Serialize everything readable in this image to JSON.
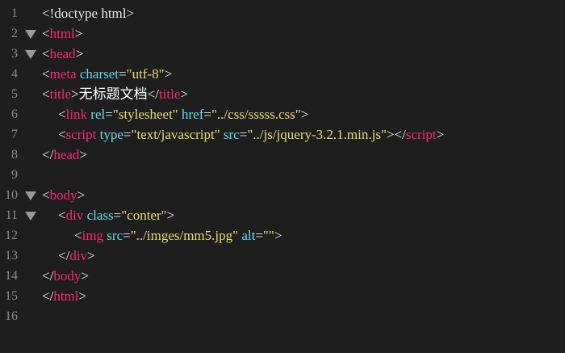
{
  "colors": {
    "background": "#1e1e1e",
    "line_number": "#8a8a8a",
    "fold_marker": "#9a9a9a",
    "punctuation": "#e8e8e8",
    "tag": "#f92672",
    "attr": "#66d9ef",
    "string": "#e6db74",
    "text": "#ffffff"
  },
  "editor": {
    "lines": [
      {
        "num": "1",
        "fold": false,
        "indent": 0,
        "tokens": [
          {
            "t": "<!doctype html>",
            "k": "p"
          }
        ]
      },
      {
        "num": "2",
        "fold": true,
        "indent": 0,
        "tokens": [
          {
            "t": "<",
            "k": "p"
          },
          {
            "t": "html",
            "k": "tag"
          },
          {
            "t": ">",
            "k": "p"
          }
        ]
      },
      {
        "num": "3",
        "fold": true,
        "indent": 0,
        "tokens": [
          {
            "t": "<",
            "k": "p"
          },
          {
            "t": "head",
            "k": "tag"
          },
          {
            "t": ">",
            "k": "p"
          }
        ]
      },
      {
        "num": "4",
        "fold": false,
        "indent": 0,
        "tokens": [
          {
            "t": "<",
            "k": "p"
          },
          {
            "t": "meta",
            "k": "tag"
          },
          {
            "t": " ",
            "k": "p"
          },
          {
            "t": "charset",
            "k": "attr"
          },
          {
            "t": "=",
            "k": "p"
          },
          {
            "t": "\"utf-8\"",
            "k": "str"
          },
          {
            "t": ">",
            "k": "p"
          }
        ]
      },
      {
        "num": "5",
        "fold": false,
        "indent": 0,
        "tokens": [
          {
            "t": "<",
            "k": "p"
          },
          {
            "t": "title",
            "k": "tag"
          },
          {
            "t": ">",
            "k": "p"
          },
          {
            "t": "无标题文档",
            "k": "text"
          },
          {
            "t": "</",
            "k": "p"
          },
          {
            "t": "title",
            "k": "tag"
          },
          {
            "t": ">",
            "k": "p"
          }
        ]
      },
      {
        "num": "6",
        "fold": false,
        "indent": 1,
        "tokens": [
          {
            "t": "<",
            "k": "p"
          },
          {
            "t": "link",
            "k": "tag"
          },
          {
            "t": " ",
            "k": "p"
          },
          {
            "t": "rel",
            "k": "attr"
          },
          {
            "t": "=",
            "k": "p"
          },
          {
            "t": "\"stylesheet\"",
            "k": "str"
          },
          {
            "t": " ",
            "k": "p"
          },
          {
            "t": "href",
            "k": "attr"
          },
          {
            "t": "=",
            "k": "p"
          },
          {
            "t": "\"../css/sssss.css\"",
            "k": "str"
          },
          {
            "t": ">",
            "k": "p"
          }
        ]
      },
      {
        "num": "7",
        "fold": false,
        "indent": 1,
        "tokens": [
          {
            "t": "<",
            "k": "p"
          },
          {
            "t": "script",
            "k": "tag"
          },
          {
            "t": " ",
            "k": "p"
          },
          {
            "t": "type",
            "k": "attr"
          },
          {
            "t": "=",
            "k": "p"
          },
          {
            "t": "\"text/javascript\"",
            "k": "str"
          },
          {
            "t": " ",
            "k": "p"
          },
          {
            "t": "src",
            "k": "attr"
          },
          {
            "t": "=",
            "k": "p"
          },
          {
            "t": "\"../js/jquery-3.2.1.min.js\"",
            "k": "str"
          },
          {
            "t": "></",
            "k": "p"
          },
          {
            "t": "script",
            "k": "tag"
          },
          {
            "t": ">",
            "k": "p"
          }
        ]
      },
      {
        "num": "8",
        "fold": false,
        "indent": 0,
        "tokens": [
          {
            "t": "</",
            "k": "p"
          },
          {
            "t": "head",
            "k": "tag"
          },
          {
            "t": ">",
            "k": "p"
          }
        ]
      },
      {
        "num": "9",
        "fold": false,
        "indent": 0,
        "tokens": []
      },
      {
        "num": "10",
        "fold": true,
        "indent": 0,
        "tokens": [
          {
            "t": "<",
            "k": "p"
          },
          {
            "t": "body",
            "k": "tag"
          },
          {
            "t": ">",
            "k": "p"
          }
        ]
      },
      {
        "num": "11",
        "fold": true,
        "indent": 1,
        "tokens": [
          {
            "t": "<",
            "k": "p"
          },
          {
            "t": "div",
            "k": "tag"
          },
          {
            "t": " ",
            "k": "p"
          },
          {
            "t": "class",
            "k": "attr"
          },
          {
            "t": "=",
            "k": "p"
          },
          {
            "t": "\"conter\"",
            "k": "str"
          },
          {
            "t": ">",
            "k": "p"
          }
        ]
      },
      {
        "num": "12",
        "fold": false,
        "indent": 2,
        "tokens": [
          {
            "t": "<",
            "k": "p"
          },
          {
            "t": "img",
            "k": "tag"
          },
          {
            "t": " ",
            "k": "p"
          },
          {
            "t": "src",
            "k": "attr"
          },
          {
            "t": "=",
            "k": "p"
          },
          {
            "t": "\"../imges/mm5.jpg\"",
            "k": "str"
          },
          {
            "t": " ",
            "k": "p"
          },
          {
            "t": "alt",
            "k": "attr"
          },
          {
            "t": "=",
            "k": "p"
          },
          {
            "t": "\"\"",
            "k": "str"
          },
          {
            "t": ">",
            "k": "p"
          }
        ]
      },
      {
        "num": "13",
        "fold": false,
        "indent": 1,
        "tokens": [
          {
            "t": "</",
            "k": "p"
          },
          {
            "t": "div",
            "k": "tag"
          },
          {
            "t": ">",
            "k": "p"
          }
        ]
      },
      {
        "num": "14",
        "fold": false,
        "indent": 0,
        "tokens": [
          {
            "t": "</",
            "k": "p"
          },
          {
            "t": "body",
            "k": "tag"
          },
          {
            "t": ">",
            "k": "p"
          }
        ]
      },
      {
        "num": "15",
        "fold": false,
        "indent": 0,
        "tokens": [
          {
            "t": "</",
            "k": "p"
          },
          {
            "t": "html",
            "k": "tag"
          },
          {
            "t": ">",
            "k": "p"
          }
        ]
      },
      {
        "num": "16",
        "fold": false,
        "indent": 0,
        "tokens": []
      }
    ]
  }
}
